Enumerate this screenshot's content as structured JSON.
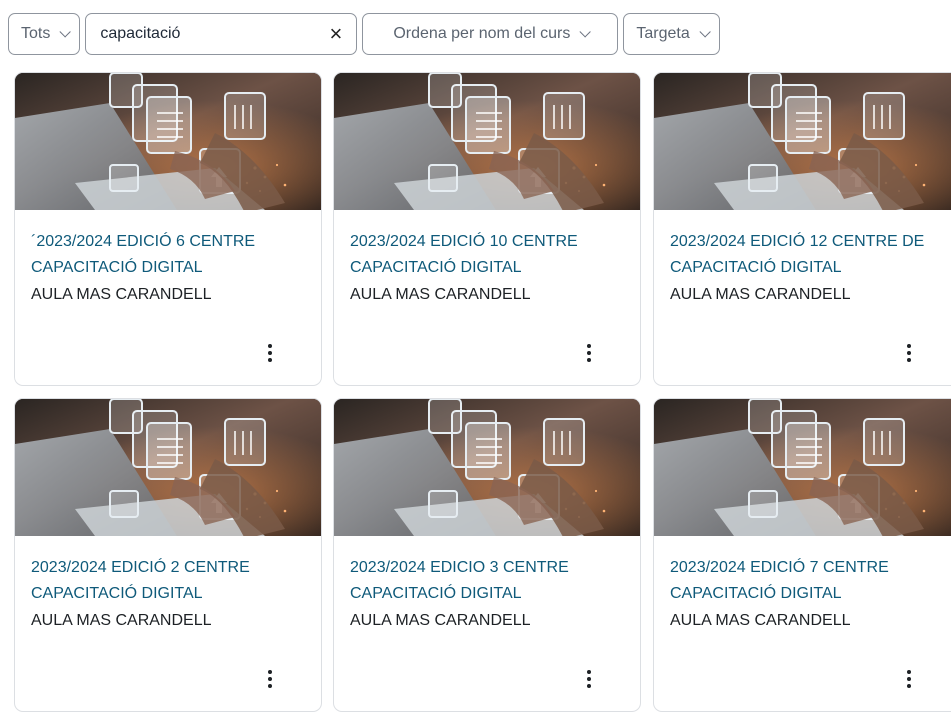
{
  "filters": {
    "status_label": "Tots",
    "search_value": "capacitació",
    "clear_glyph": "×",
    "sort_label": "Ordena per nom del curs",
    "view_label": "Targeta"
  },
  "courses": [
    {
      "title": "´2023/2024 EDICIÓ 6 CENTRE CAPACITACIÓ DIGITAL",
      "organization": "AULA MAS CARANDELL"
    },
    {
      "title": "2023/2024 EDICIÓ 10 CENTRE CAPACITACIÓ DIGITAL",
      "organization": "AULA MAS CARANDELL"
    },
    {
      "title": "2023/2024 EDICIÓ 12 CENTRE DE CAPACITACIÓ DIGITAL",
      "organization": "AULA MAS CARANDELL"
    },
    {
      "title": "2023/2024 EDICIÓ 2 CENTRE CAPACITACIÓ DIGITAL",
      "organization": "AULA MAS CARANDELL"
    },
    {
      "title": "2023/2024 EDICIO 3 CENTRE CAPACITACIÓ DIGITAL",
      "organization": "AULA MAS CARANDELL"
    },
    {
      "title": "2023/2024 EDICIÓ 7 CENTRE CAPACITACIÓ DIGITAL",
      "organization": "AULA MAS CARANDELL"
    }
  ],
  "colors": {
    "title_link": "#0f5a7a",
    "border": "#dcdfe3"
  }
}
